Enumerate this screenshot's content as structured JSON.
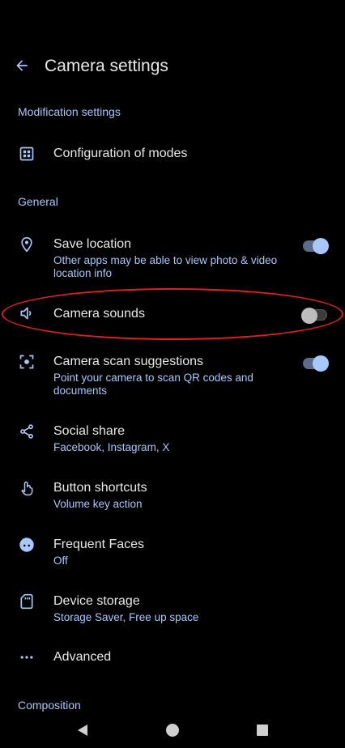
{
  "header": {
    "title": "Camera settings",
    "back_icon": "arrow-back-icon"
  },
  "sections": {
    "modification": "Modification settings",
    "general": "General",
    "composition": "Composition"
  },
  "items": {
    "modes": {
      "label": "Configuration of modes",
      "icon": "modes-grid-icon"
    },
    "save_location": {
      "label": "Save location",
      "summary": "Other apps may be able to view photo & video location info",
      "toggle": "on",
      "icon": "location-pin-icon"
    },
    "camera_sounds": {
      "label": "Camera sounds",
      "toggle": "off",
      "icon": "speaker-icon"
    },
    "scan_suggestions": {
      "label": "Camera scan suggestions",
      "summary": "Point your camera to scan QR codes and documents",
      "toggle": "on",
      "icon": "scan-icon"
    },
    "social_share": {
      "label": "Social share",
      "summary": "Facebook, Instagram, X",
      "icon": "share-icon"
    },
    "button_shortcuts": {
      "label": "Button shortcuts",
      "summary": "Volume key action",
      "icon": "touch-icon"
    },
    "frequent_faces": {
      "label": "Frequent Faces",
      "summary": "Off",
      "icon": "face-icon"
    },
    "device_storage": {
      "label": "Device storage",
      "summary": "Storage Saver, Free up space",
      "icon": "sd-card-icon"
    },
    "advanced": {
      "label": "Advanced",
      "icon": "more-horiz-icon"
    }
  },
  "colors": {
    "accent": "#a8c7fa",
    "background": "#000000",
    "annotation": "#e02020"
  }
}
